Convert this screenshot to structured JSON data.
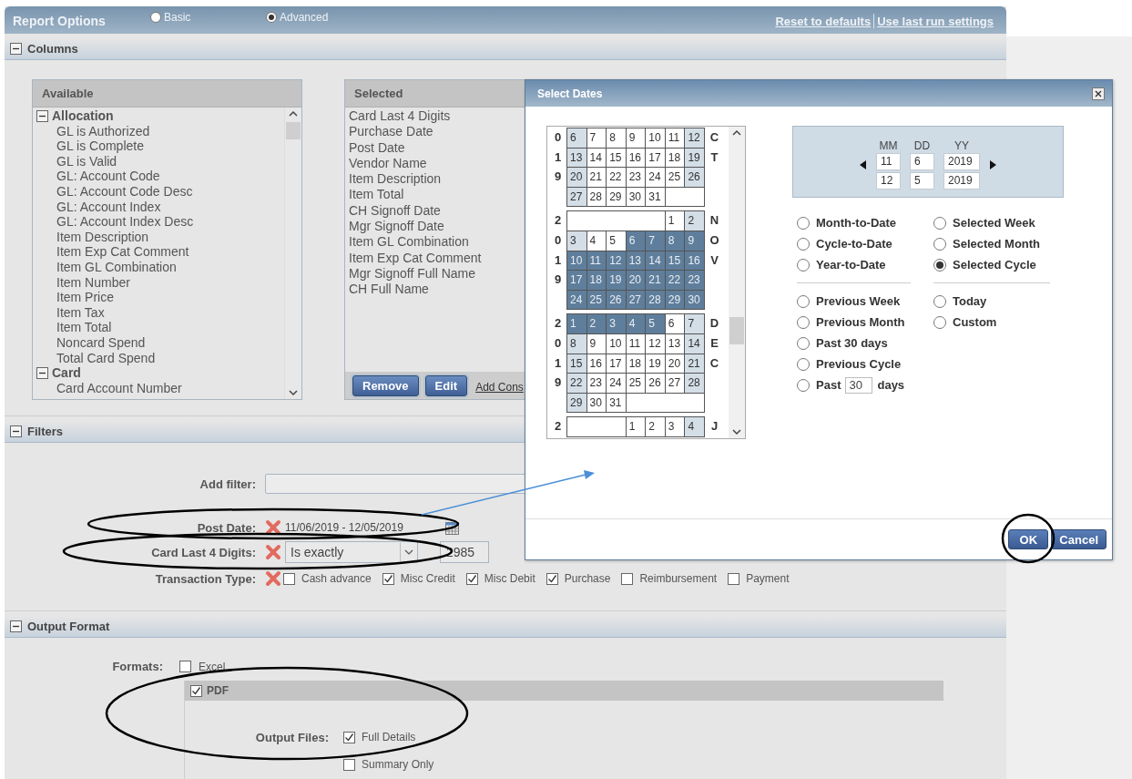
{
  "report_options": {
    "title": "Report Options",
    "modes": [
      {
        "label": "Basic",
        "selected": false
      },
      {
        "label": "Advanced",
        "selected": true
      }
    ],
    "links": [
      "Reset to defaults",
      "Use last run settings"
    ]
  },
  "columns_section": {
    "title": "Columns",
    "expanded": true,
    "available": {
      "title": "Available",
      "groups": [
        {
          "label": "Allocation",
          "expanded": true,
          "children": [
            {
              "label": "GL is Authorized"
            },
            {
              "label": "GL is Complete"
            },
            {
              "label": "GL is Valid"
            },
            {
              "label": "GL: Account Code"
            },
            {
              "label": "GL: Account Code Desc"
            },
            {
              "label": "GL: Account Index"
            },
            {
              "label": "GL: Account Index Desc"
            },
            {
              "label": "Item Description"
            },
            {
              "label": "Item Exp Cat Comment"
            },
            {
              "label": "Item GL Combination"
            },
            {
              "label": "Item Number"
            },
            {
              "label": "Item Price"
            },
            {
              "label": "Item Tax"
            },
            {
              "label": "Item Total"
            },
            {
              "label": "Noncard Spend"
            },
            {
              "label": "Total Card Spend"
            }
          ]
        },
        {
          "label": "Card",
          "expanded": true,
          "children": [
            {
              "label": "Card Account Number"
            }
          ]
        }
      ]
    },
    "selected": {
      "title": "Selected",
      "items": [
        "Card Last 4 Digits",
        "Purchase Date",
        "Post Date",
        "Vendor Name",
        "Item Description",
        "Item Total",
        "CH Signoff Date",
        "Mgr Signoff Date",
        "Item GL Combination",
        "Item Exp Cat Comment",
        "Mgr Signoff Full Name",
        "CH Full Name"
      ],
      "buttons": [
        "Remove",
        "Edit"
      ],
      "link": "Add Cons"
    }
  },
  "filters_section": {
    "title": "Filters",
    "expanded": true,
    "add_filter": {
      "label": "Add filter:"
    },
    "post_date": {
      "label": "Post Date:",
      "value": "11/06/2019 - 12/05/2019"
    },
    "card_last4": {
      "label": "Card Last 4 Digits:",
      "operator": "Is exactly",
      "value": "2985"
    },
    "transaction_type": {
      "label": "Transaction Type:",
      "options": [
        {
          "label": "Cash advance",
          "checked": false
        },
        {
          "label": "Misc Credit",
          "checked": true
        },
        {
          "label": "Misc Debit",
          "checked": true
        },
        {
          "label": "Purchase",
          "checked": true
        },
        {
          "label": "Reimbursement",
          "checked": false
        },
        {
          "label": "Payment",
          "checked": false
        }
      ]
    }
  },
  "output_section": {
    "title": "Output Format",
    "expanded": true,
    "formats_label": "Formats:",
    "excel": {
      "label": "Excel",
      "checked": false
    },
    "pdf": {
      "label": "PDF",
      "checked": true,
      "output_files_label": "Output Files:",
      "options": [
        {
          "label": "Full Details",
          "checked": true
        },
        {
          "label": "Summary Only",
          "checked": false
        }
      ]
    }
  },
  "dialog": {
    "title": "Select Dates",
    "calendar": {
      "months": [
        {
          "year_label": "019",
          "month_label": "CT",
          "weeks": [
            [
              {
                "kind": "day",
                "day": "6",
                "weekend": true,
                "selected": false
              },
              {
                "kind": "day",
                "day": "7",
                "weekend": false,
                "selected": false
              },
              {
                "kind": "day",
                "day": "8",
                "weekend": false,
                "selected": false
              },
              {
                "kind": "day",
                "day": "9",
                "weekend": false,
                "selected": false
              },
              {
                "kind": "day",
                "day": "10",
                "weekend": false,
                "selected": false
              },
              {
                "kind": "day",
                "day": "11",
                "weekend": false,
                "selected": false
              },
              {
                "kind": "day",
                "day": "12",
                "weekend": true,
                "selected": false
              }
            ],
            [
              {
                "kind": "day",
                "day": "13",
                "weekend": true,
                "selected": false
              },
              {
                "kind": "day",
                "day": "14",
                "weekend": false,
                "selected": false
              },
              {
                "kind": "day",
                "day": "15",
                "weekend": false,
                "selected": false
              },
              {
                "kind": "day",
                "day": "16",
                "weekend": false,
                "selected": false
              },
              {
                "kind": "day",
                "day": "17",
                "weekend": false,
                "selected": false
              },
              {
                "kind": "day",
                "day": "18",
                "weekend": false,
                "selected": false
              },
              {
                "kind": "day",
                "day": "19",
                "weekend": true,
                "selected": false
              }
            ],
            [
              {
                "kind": "day",
                "day": "20",
                "weekend": true,
                "selected": false
              },
              {
                "kind": "day",
                "day": "21",
                "weekend": false,
                "selected": false
              },
              {
                "kind": "day",
                "day": "22",
                "weekend": false,
                "selected": false
              },
              {
                "kind": "day",
                "day": "23",
                "weekend": false,
                "selected": false
              },
              {
                "kind": "day",
                "day": "24",
                "weekend": false,
                "selected": false
              },
              {
                "kind": "day",
                "day": "25",
                "weekend": false,
                "selected": false
              },
              {
                "kind": "day",
                "day": "26",
                "weekend": true,
                "selected": false
              }
            ],
            [
              {
                "kind": "day",
                "day": "27",
                "weekend": true,
                "selected": false
              },
              {
                "kind": "day",
                "day": "28",
                "weekend": false,
                "selected": false
              },
              {
                "kind": "day",
                "day": "29",
                "weekend": false,
                "selected": false
              },
              {
                "kind": "day",
                "day": "30",
                "weekend": false,
                "selected": false
              },
              {
                "kind": "day",
                "day": "31",
                "weekend": false,
                "selected": false
              },
              {
                "kind": "blank"
              },
              {
                "kind": "blank"
              }
            ]
          ]
        },
        {
          "year_label": "2019",
          "month_label": "NOV",
          "weeks": [
            [
              {
                "kind": "blank"
              },
              {
                "kind": "blank"
              },
              {
                "kind": "blank"
              },
              {
                "kind": "blank"
              },
              {
                "kind": "blank"
              },
              {
                "kind": "day",
                "day": "1",
                "weekend": false,
                "selected": false
              },
              {
                "kind": "day",
                "day": "2",
                "weekend": true,
                "selected": false
              }
            ],
            [
              {
                "kind": "day",
                "day": "3",
                "weekend": true,
                "selected": false
              },
              {
                "kind": "day",
                "day": "4",
                "weekend": false,
                "selected": false
              },
              {
                "kind": "day",
                "day": "5",
                "weekend": false,
                "selected": false
              },
              {
                "kind": "day",
                "day": "6",
                "selected": true
              },
              {
                "kind": "day",
                "day": "7",
                "selected": true
              },
              {
                "kind": "day",
                "day": "8",
                "selected": true
              },
              {
                "kind": "day",
                "day": "9",
                "selected": true
              }
            ],
            [
              {
                "kind": "day",
                "day": "10",
                "selected": true
              },
              {
                "kind": "day",
                "day": "11",
                "selected": true
              },
              {
                "kind": "day",
                "day": "12",
                "selected": true
              },
              {
                "kind": "day",
                "day": "13",
                "selected": true
              },
              {
                "kind": "day",
                "day": "14",
                "selected": true
              },
              {
                "kind": "day",
                "day": "15",
                "selected": true
              },
              {
                "kind": "day",
                "day": "16",
                "selected": true
              }
            ],
            [
              {
                "kind": "day",
                "day": "17",
                "selected": true
              },
              {
                "kind": "day",
                "day": "18",
                "selected": true
              },
              {
                "kind": "day",
                "day": "19",
                "selected": true
              },
              {
                "kind": "day",
                "day": "20",
                "selected": true
              },
              {
                "kind": "day",
                "day": "21",
                "selected": true
              },
              {
                "kind": "day",
                "day": "22",
                "selected": true
              },
              {
                "kind": "day",
                "day": "23",
                "selected": true
              }
            ],
            [
              {
                "kind": "day",
                "day": "24",
                "selected": true
              },
              {
                "kind": "day",
                "day": "25",
                "selected": true
              },
              {
                "kind": "day",
                "day": "26",
                "selected": true
              },
              {
                "kind": "day",
                "day": "27",
                "selected": true
              },
              {
                "kind": "day",
                "day": "28",
                "selected": true
              },
              {
                "kind": "day",
                "day": "29",
                "selected": true
              },
              {
                "kind": "day",
                "day": "30",
                "selected": true
              }
            ]
          ]
        },
        {
          "year_label": "2019",
          "month_label": "DEC",
          "weeks": [
            [
              {
                "kind": "day",
                "day": "1",
                "selected": true
              },
              {
                "kind": "day",
                "day": "2",
                "selected": true
              },
              {
                "kind": "day",
                "day": "3",
                "selected": true
              },
              {
                "kind": "day",
                "day": "4",
                "selected": true
              },
              {
                "kind": "day",
                "day": "5",
                "selected": true
              },
              {
                "kind": "day",
                "day": "6",
                "weekend": false,
                "selected": false
              },
              {
                "kind": "day",
                "day": "7",
                "weekend": true,
                "selected": false
              }
            ],
            [
              {
                "kind": "day",
                "day": "8",
                "weekend": true,
                "selected": false
              },
              {
                "kind": "day",
                "day": "9",
                "weekend": false,
                "selected": false
              },
              {
                "kind": "day",
                "day": "10",
                "weekend": false,
                "selected": false
              },
              {
                "kind": "day",
                "day": "11",
                "weekend": false,
                "selected": false
              },
              {
                "kind": "day",
                "day": "12",
                "weekend": false,
                "selected": false
              },
              {
                "kind": "day",
                "day": "13",
                "weekend": false,
                "selected": false
              },
              {
                "kind": "day",
                "day": "14",
                "weekend": true,
                "selected": false
              }
            ],
            [
              {
                "kind": "day",
                "day": "15",
                "weekend": true,
                "selected": false
              },
              {
                "kind": "day",
                "day": "16",
                "weekend": false,
                "selected": false
              },
              {
                "kind": "day",
                "day": "17",
                "weekend": false,
                "selected": false
              },
              {
                "kind": "day",
                "day": "18",
                "weekend": false,
                "selected": false
              },
              {
                "kind": "day",
                "day": "19",
                "weekend": false,
                "selected": false
              },
              {
                "kind": "day",
                "day": "20",
                "weekend": false,
                "selected": false
              },
              {
                "kind": "day",
                "day": "21",
                "weekend": true,
                "selected": false
              }
            ],
            [
              {
                "kind": "day",
                "day": "22",
                "weekend": true,
                "selected": false
              },
              {
                "kind": "day",
                "day": "23",
                "weekend": false,
                "selected": false
              },
              {
                "kind": "day",
                "day": "24",
                "weekend": false,
                "selected": false
              },
              {
                "kind": "day",
                "day": "25",
                "weekend": false,
                "selected": false
              },
              {
                "kind": "day",
                "day": "26",
                "weekend": false,
                "selected": false
              },
              {
                "kind": "day",
                "day": "27",
                "weekend": false,
                "selected": false
              },
              {
                "kind": "day",
                "day": "28",
                "weekend": true,
                "selected": false
              }
            ],
            [
              {
                "kind": "day",
                "day": "29",
                "weekend": true,
                "selected": false
              },
              {
                "kind": "day",
                "day": "30",
                "weekend": false,
                "selected": false
              },
              {
                "kind": "day",
                "day": "31",
                "weekend": false,
                "selected": false
              },
              {
                "kind": "blank"
              },
              {
                "kind": "blank"
              },
              {
                "kind": "blank"
              },
              {
                "kind": "blank"
              }
            ]
          ]
        },
        {
          "year_label": "2",
          "month_label": "J",
          "weeks": [
            [
              {
                "kind": "blank"
              },
              {
                "kind": "blank"
              },
              {
                "kind": "blank"
              },
              {
                "kind": "day",
                "day": "1",
                "weekend": false,
                "selected": false
              },
              {
                "kind": "day",
                "day": "2",
                "weekend": false,
                "selected": false
              },
              {
                "kind": "day",
                "day": "3",
                "weekend": false,
                "selected": false
              },
              {
                "kind": "day",
                "day": "4",
                "weekend": true,
                "selected": false
              }
            ]
          ]
        }
      ]
    },
    "range": {
      "headers": [
        "MM",
        "DD",
        "YY"
      ],
      "from": [
        "11",
        "6",
        "2019"
      ],
      "to": [
        "12",
        "5",
        "2019"
      ]
    },
    "preset_columns": [
      {
        "groups": [
          [
            {
              "kind": "plain",
              "label": "Month-to-Date",
              "selected": false
            },
            {
              "kind": "plain",
              "label": "Cycle-to-Date",
              "selected": false
            },
            {
              "kind": "plain",
              "label": "Year-to-Date",
              "selected": false
            }
          ],
          [
            {
              "kind": "plain",
              "label": "Previous Week",
              "selected": false
            },
            {
              "kind": "plain",
              "label": "Previous Month",
              "selected": false
            },
            {
              "kind": "plain",
              "label": "Past 30 days",
              "selected": false
            },
            {
              "kind": "plain",
              "label": "Previous Cycle",
              "selected": false
            },
            {
              "kind": "past_n",
              "label": "Past",
              "value": "30",
              "suffix": "days",
              "selected": false
            }
          ]
        ]
      },
      {
        "groups": [
          [
            {
              "kind": "plain",
              "label": "Selected Week",
              "selected": false
            },
            {
              "kind": "plain",
              "label": "Selected Month",
              "selected": false
            },
            {
              "kind": "plain",
              "label": "Selected Cycle",
              "selected": true
            }
          ],
          [
            {
              "kind": "plain",
              "label": "Today",
              "selected": false
            },
            {
              "kind": "plain",
              "label": "Custom",
              "selected": false
            }
          ]
        ]
      }
    ],
    "buttons": [
      "OK",
      "Cancel"
    ]
  }
}
